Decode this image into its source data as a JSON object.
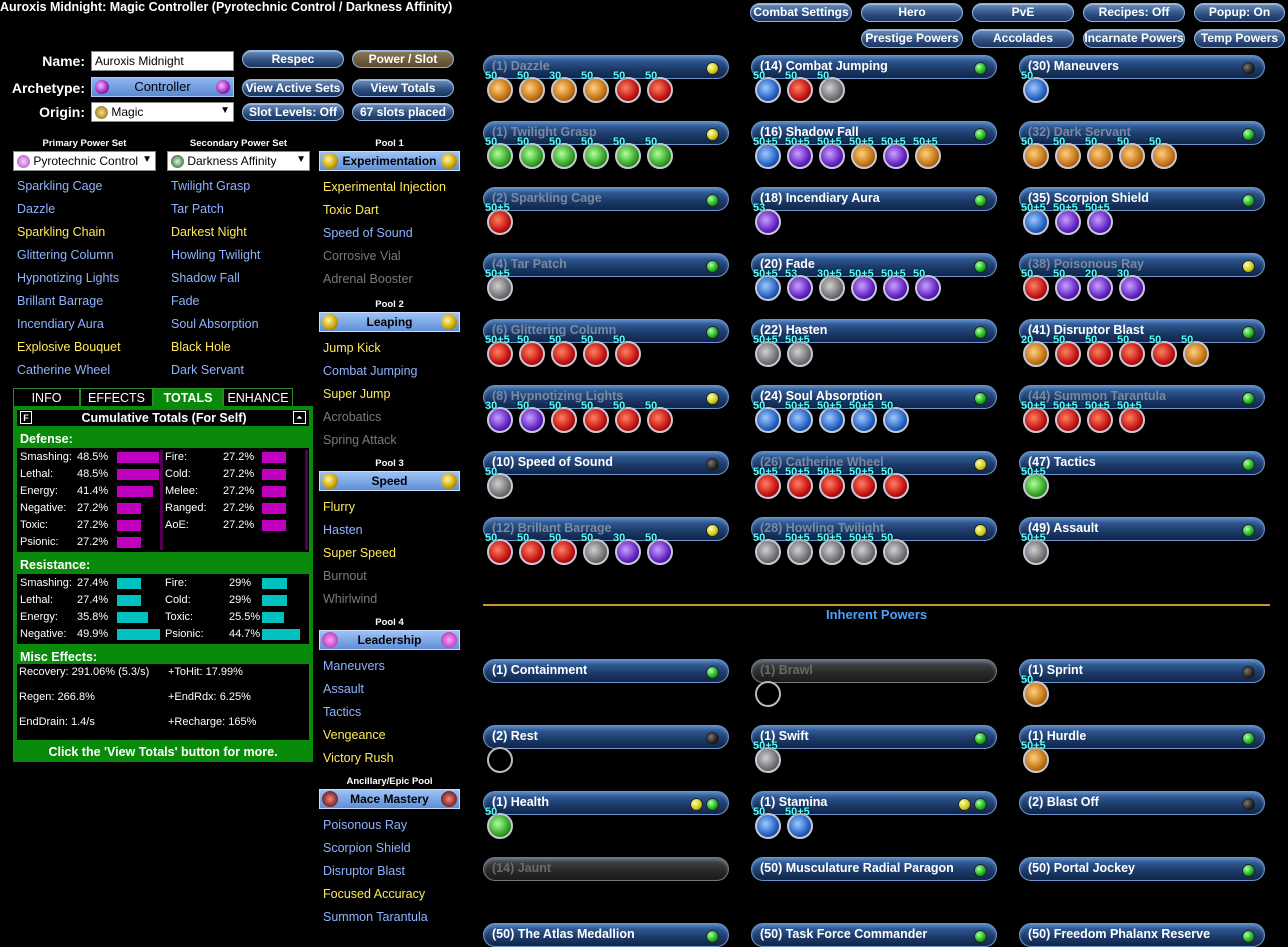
{
  "title": "Auroxis Midnight: Magic Controller (Pyrotechnic Control / Darkness Affinity)",
  "top_buttons": [
    "Combat Settings",
    "Hero",
    "PvE",
    "Recipes: Off",
    "Popup: On",
    "Prestige Powers",
    "Accolades",
    "Incarnate Powers",
    "Temp Powers"
  ],
  "form": {
    "name_label": "Name:",
    "name_value": "Auroxis Midnight",
    "archetype_label": "Archetype:",
    "archetype_value": "Controller",
    "origin_label": "Origin:",
    "origin_value": "Magic",
    "buttons": [
      "Respec",
      "Power / Slot",
      "View Active Sets",
      "View Totals",
      "Slot Levels: Off",
      "67 slots placed"
    ]
  },
  "primary_header": "Primary Power Set",
  "secondary_header": "Secondary Power Set",
  "primary_set": "Pyrotechnic Control",
  "secondary_set": "Darkness Affinity",
  "primary_powers": [
    {
      "t": "Sparkling Cage",
      "c": "blue"
    },
    {
      "t": "Dazzle",
      "c": "blue"
    },
    {
      "t": "Sparkling Chain",
      "c": "yel"
    },
    {
      "t": "Glittering Column",
      "c": "blue"
    },
    {
      "t": "Hypnotizing Lights",
      "c": "blue"
    },
    {
      "t": "Brillant Barrage",
      "c": "blue"
    },
    {
      "t": "Incendiary Aura",
      "c": "blue"
    },
    {
      "t": "Explosive Bouquet",
      "c": "yel"
    },
    {
      "t": "Catherine Wheel",
      "c": "blue"
    }
  ],
  "secondary_powers": [
    {
      "t": "Twilight Grasp",
      "c": "blue"
    },
    {
      "t": "Tar Patch",
      "c": "blue"
    },
    {
      "t": "Darkest Night",
      "c": "yel"
    },
    {
      "t": "Howling Twilight",
      "c": "blue"
    },
    {
      "t": "Shadow Fall",
      "c": "blue"
    },
    {
      "t": "Fade",
      "c": "blue"
    },
    {
      "t": "Soul Absorption",
      "c": "blue"
    },
    {
      "t": "Black Hole",
      "c": "yel"
    },
    {
      "t": "Dark Servant",
      "c": "blue"
    }
  ],
  "pools": [
    {
      "hdr": "Pool 1",
      "name": "Experimentation",
      "items": [
        {
          "t": "Experimental Injection",
          "c": "yel"
        },
        {
          "t": "Toxic Dart",
          "c": "yel"
        },
        {
          "t": "Speed of Sound",
          "c": "blue"
        },
        {
          "t": "Corrosive Vial",
          "c": "gray"
        },
        {
          "t": "Adrenal Booster",
          "c": "gray"
        }
      ]
    },
    {
      "hdr": "Pool 2",
      "name": "Leaping",
      "items": [
        {
          "t": "Jump Kick",
          "c": "yel"
        },
        {
          "t": "Combat Jumping",
          "c": "blue"
        },
        {
          "t": "Super Jump",
          "c": "yel"
        },
        {
          "t": "Acrobatics",
          "c": "gray"
        },
        {
          "t": "Spring Attack",
          "c": "gray"
        }
      ]
    },
    {
      "hdr": "Pool 3",
      "name": "Speed",
      "items": [
        {
          "t": "Flurry",
          "c": "yel"
        },
        {
          "t": "Hasten",
          "c": "blue"
        },
        {
          "t": "Super Speed",
          "c": "yel"
        },
        {
          "t": "Burnout",
          "c": "gray"
        },
        {
          "t": "Whirlwind",
          "c": "gray"
        }
      ]
    },
    {
      "hdr": "Pool 4",
      "name": "Leadership",
      "items": [
        {
          "t": "Maneuvers",
          "c": "blue"
        },
        {
          "t": "Assault",
          "c": "blue"
        },
        {
          "t": "Tactics",
          "c": "blue"
        },
        {
          "t": "Vengeance",
          "c": "yel"
        },
        {
          "t": "Victory Rush",
          "c": "yel"
        }
      ]
    },
    {
      "hdr": "Ancillary/Epic Pool",
      "name": "Mace Mastery",
      "items": [
        {
          "t": "Poisonous Ray",
          "c": "blue"
        },
        {
          "t": "Scorpion Shield",
          "c": "blue"
        },
        {
          "t": "Disruptor Blast",
          "c": "blue"
        },
        {
          "t": "Focused Accuracy",
          "c": "yel"
        },
        {
          "t": "Summon Tarantula",
          "c": "blue"
        }
      ]
    }
  ],
  "tabs": [
    "INFO",
    "EFFECTS",
    "TOTALS",
    "ENHANCE"
  ],
  "totals": {
    "header": "Cumulative Totals (For Self)",
    "defense_label": "Defense:",
    "defense_left": [
      [
        "Smashing:",
        "48.5%",
        0.97
      ],
      [
        "Lethal:",
        "48.5%",
        0.97
      ],
      [
        "Energy:",
        "41.4%",
        0.83
      ],
      [
        "Negative:",
        "27.2%",
        0.55
      ],
      [
        "Toxic:",
        "27.2%",
        0.55
      ],
      [
        "Psionic:",
        "27.2%",
        0.55
      ]
    ],
    "defense_right": [
      [
        "Fire:",
        "27.2%",
        0.55
      ],
      [
        "Cold:",
        "27.2%",
        0.55
      ],
      [
        "Melee:",
        "27.2%",
        0.55
      ],
      [
        "Ranged:",
        "27.2%",
        0.55
      ],
      [
        "AoE:",
        "27.2%",
        0.55
      ]
    ],
    "resistance_label": "Resistance:",
    "res_left": [
      [
        "Smashing:",
        "27.4%",
        0.55
      ],
      [
        "Lethal:",
        "27.4%",
        0.55
      ],
      [
        "Energy:",
        "35.8%",
        0.72
      ],
      [
        "Negative:",
        "49.9%",
        1.0
      ]
    ],
    "res_right": [
      [
        "Fire:",
        "29%",
        0.58
      ],
      [
        "Cold:",
        "29%",
        0.58
      ],
      [
        "Toxic:",
        "25.5%",
        0.51
      ],
      [
        "Psionic:",
        "44.7%",
        0.89
      ]
    ],
    "misc_label": "Misc Effects:",
    "misc": [
      [
        "Recovery:",
        "291.06% (5.3/s)"
      ],
      [
        "+ToHit:",
        "17.99%"
      ],
      [
        "Regen:",
        "266.8%"
      ],
      [
        "+EndRdx:",
        "6.25%"
      ],
      [
        "EndDrain:",
        "1.4/s"
      ],
      [
        "+Recharge:",
        "165%"
      ]
    ],
    "footer": "Click the 'View Totals' button for more."
  },
  "inherent_label": "Inherent Powers",
  "powers": [
    {
      "n": "(1) Dazzle",
      "st": "dim",
      "led": "y",
      "sl": [
        [
          "50",
          "o"
        ],
        [
          "50",
          "o"
        ],
        [
          "30",
          "o"
        ],
        [
          "50",
          "o"
        ],
        [
          "50",
          "r"
        ],
        [
          "50",
          "r"
        ]
      ]
    },
    {
      "n": "(14) Combat Jumping",
      "st": "",
      "led": "g",
      "sl": [
        [
          "50",
          "b"
        ],
        [
          "50",
          "r"
        ],
        [
          "50",
          "gr"
        ]
      ]
    },
    {
      "n": "(30) Maneuvers",
      "st": "",
      "led": "k",
      "sl": [
        [
          "50",
          "b"
        ]
      ]
    },
    {
      "n": "(1) Twilight Grasp",
      "st": "dim",
      "led": "y",
      "sl": [
        [
          "50",
          "gn"
        ],
        [
          "50",
          "gn"
        ],
        [
          "50",
          "gn"
        ],
        [
          "50",
          "gn"
        ],
        [
          "50",
          "gn"
        ],
        [
          "50",
          "gn"
        ]
      ]
    },
    {
      "n": "(16) Shadow Fall",
      "st": "",
      "led": "g",
      "sl": [
        [
          "50+5",
          "b"
        ],
        [
          "50+5",
          "v"
        ],
        [
          "50+5",
          "v"
        ],
        [
          "50+5",
          "o"
        ],
        [
          "50+5",
          "v"
        ],
        [
          "50+5",
          "o"
        ]
      ]
    },
    {
      "n": "(32) Dark Servant",
      "st": "dim",
      "led": "g",
      "sl": [
        [
          "50",
          "o"
        ],
        [
          "50",
          "o"
        ],
        [
          "50",
          "o"
        ],
        [
          "50",
          "o"
        ],
        [
          "50",
          "o"
        ]
      ]
    },
    {
      "n": "(2) Sparkling Cage",
      "st": "dim",
      "led": "g",
      "sl": [
        [
          "50+5",
          "r"
        ]
      ]
    },
    {
      "n": "(18) Incendiary Aura",
      "st": "",
      "led": "g",
      "sl": [
        [
          "53",
          "v"
        ]
      ]
    },
    {
      "n": "(35) Scorpion Shield",
      "st": "",
      "led": "g",
      "sl": [
        [
          "50+5",
          "b"
        ],
        [
          "50+5",
          "v"
        ],
        [
          "50+5",
          "v"
        ]
      ]
    },
    {
      "n": "(4) Tar Patch",
      "st": "dim",
      "led": "g",
      "sl": [
        [
          "50+5",
          "gr"
        ]
      ]
    },
    {
      "n": "(20) Fade",
      "st": "",
      "led": "g",
      "sl": [
        [
          "50+5",
          "b"
        ],
        [
          "53",
          "v"
        ],
        [
          "30+5",
          "gr"
        ],
        [
          "50+5",
          "v"
        ],
        [
          "50+5",
          "v"
        ],
        [
          "50",
          "v"
        ]
      ]
    },
    {
      "n": "(38) Poisonous Ray",
      "st": "dim",
      "led": "y",
      "sl": [
        [
          "50",
          "r"
        ],
        [
          "50",
          "v"
        ],
        [
          "20",
          "v"
        ],
        [
          "30",
          "v"
        ]
      ]
    },
    {
      "n": "(6) Glittering Column",
      "st": "dim",
      "led": "g",
      "sl": [
        [
          "50+5",
          "r"
        ],
        [
          "50",
          "r"
        ],
        [
          "50",
          "r"
        ],
        [
          "50",
          "r"
        ],
        [
          "50",
          "r"
        ]
      ]
    },
    {
      "n": "(22) Hasten",
      "st": "",
      "led": "g",
      "sl": [
        [
          "50+5",
          "gr"
        ],
        [
          "50+5",
          "gr"
        ]
      ]
    },
    {
      "n": "(41) Disruptor Blast",
      "st": "",
      "led": "g",
      "sl": [
        [
          "20",
          "o"
        ],
        [
          "50",
          "r"
        ],
        [
          "50",
          "r"
        ],
        [
          "50",
          "r"
        ],
        [
          "50",
          "r"
        ],
        [
          "50",
          "o"
        ]
      ]
    },
    {
      "n": "(8) Hypnotizing Lights",
      "st": "dim",
      "led": "y",
      "sl": [
        [
          "30",
          "v"
        ],
        [
          "50",
          "v"
        ],
        [
          "50",
          "r"
        ],
        [
          "50",
          "r"
        ],
        [
          "50",
          "r"
        ],
        [
          "50",
          "r"
        ]
      ]
    },
    {
      "n": "(24) Soul Absorption",
      "st": "",
      "led": "g",
      "sl": [
        [
          "50",
          "b"
        ],
        [
          "50+5",
          "b"
        ],
        [
          "50+5",
          "b"
        ],
        [
          "50+5",
          "b"
        ],
        [
          "50",
          "b"
        ]
      ]
    },
    {
      "n": "(44) Summon Tarantula",
      "st": "dim",
      "led": "g",
      "sl": [
        [
          "50+5",
          "r"
        ],
        [
          "50+5",
          "r"
        ],
        [
          "50+5",
          "r"
        ],
        [
          "50+5",
          "r"
        ]
      ]
    },
    {
      "n": "(10) Speed of Sound",
      "st": "",
      "led": "k",
      "sl": [
        [
          "50",
          "gr"
        ]
      ]
    },
    {
      "n": "(26) Catherine Wheel",
      "st": "dim",
      "led": "y",
      "sl": [
        [
          "50+5",
          "r"
        ],
        [
          "50+5",
          "r"
        ],
        [
          "50+5",
          "r"
        ],
        [
          "50+5",
          "r"
        ],
        [
          "50",
          "r"
        ]
      ]
    },
    {
      "n": "(47) Tactics",
      "st": "",
      "led": "g",
      "sl": [
        [
          "50+5",
          "gn"
        ]
      ]
    },
    {
      "n": "(12) Brillant Barrage",
      "st": "dim",
      "led": "y",
      "sl": [
        [
          "50",
          "r"
        ],
        [
          "50",
          "r"
        ],
        [
          "50",
          "r"
        ],
        [
          "50",
          "gr"
        ],
        [
          "30",
          "v"
        ],
        [
          "50",
          "v"
        ]
      ]
    },
    {
      "n": "(28) Howling Twilight",
      "st": "dim",
      "led": "y",
      "sl": [
        [
          "50",
          "gr"
        ],
        [
          "50+5",
          "gr"
        ],
        [
          "50+5",
          "gr"
        ],
        [
          "50+5",
          "gr"
        ],
        [
          "50",
          "gr"
        ]
      ]
    },
    {
      "n": "(49) Assault",
      "st": "",
      "led": "g",
      "sl": [
        [
          "50+5",
          "gr"
        ]
      ]
    }
  ],
  "inherent": [
    {
      "n": "(1) Containment",
      "st": "",
      "led": "g",
      "sl": []
    },
    {
      "n": "(1) Brawl",
      "st": "dis",
      "led": "",
      "sl": [
        [
          "",
          "blk"
        ]
      ]
    },
    {
      "n": "(1) Sprint",
      "st": "",
      "led": "k",
      "sl": [
        [
          "50",
          "o"
        ]
      ]
    },
    {
      "n": "(2) Rest",
      "st": "",
      "led": "k",
      "sl": [
        [
          "",
          "blk"
        ]
      ]
    },
    {
      "n": "(1) Swift",
      "st": "",
      "led": "g",
      "sl": [
        [
          "50+5",
          "gr"
        ]
      ]
    },
    {
      "n": "(1) Hurdle",
      "st": "",
      "led": "g",
      "sl": [
        [
          "50+5",
          "o"
        ]
      ]
    },
    {
      "n": "(1) Health",
      "st": "",
      "led": "yg",
      "sl": [
        [
          "50",
          "gn"
        ]
      ]
    },
    {
      "n": "(1) Stamina",
      "st": "",
      "led": "yg",
      "sl": [
        [
          "50",
          "b"
        ],
        [
          "50+5",
          "b"
        ]
      ]
    },
    {
      "n": "(2) Blast Off",
      "st": "",
      "led": "k",
      "sl": []
    },
    {
      "n": "(14) Jaunt",
      "st": "dis",
      "led": "",
      "sl": []
    },
    {
      "n": "(50) Musculature Radial Paragon",
      "st": "",
      "led": "g",
      "sl": []
    },
    {
      "n": "(50) Portal Jockey",
      "st": "",
      "led": "g",
      "sl": []
    },
    {
      "n": "(50) The Atlas Medallion",
      "st": "",
      "led": "g",
      "sl": []
    },
    {
      "n": "(50) Task Force Commander",
      "st": "",
      "led": "g",
      "sl": []
    },
    {
      "n": "(50) Freedom Phalanx Reserve",
      "st": "",
      "led": "g",
      "sl": []
    }
  ]
}
